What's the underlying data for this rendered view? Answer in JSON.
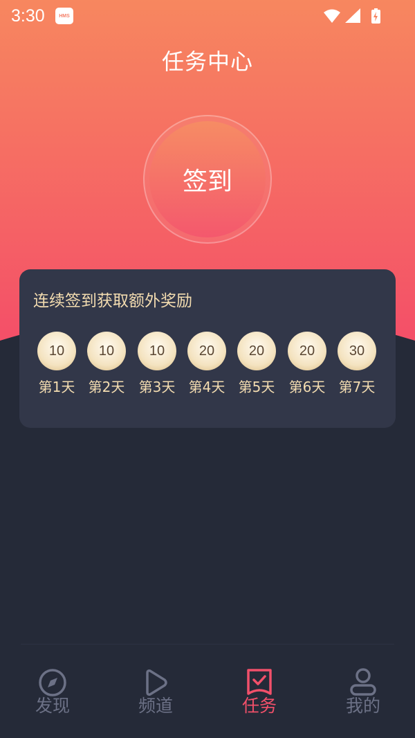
{
  "status_bar": {
    "time": "3:30",
    "badge": "HMS"
  },
  "page": {
    "title": "任务中心"
  },
  "checkin": {
    "button_label": "签到"
  },
  "reward_card": {
    "title": "连续签到获取额外奖励",
    "days": [
      {
        "points": "10",
        "label": "第1天"
      },
      {
        "points": "10",
        "label": "第2天"
      },
      {
        "points": "10",
        "label": "第3天"
      },
      {
        "points": "20",
        "label": "第4天"
      },
      {
        "points": "20",
        "label": "第5天"
      },
      {
        "points": "20",
        "label": "第6天"
      },
      {
        "points": "30",
        "label": "第7天"
      }
    ]
  },
  "bottom_nav": {
    "items": [
      {
        "label": "发现",
        "icon": "compass-icon",
        "active": false
      },
      {
        "label": "频道",
        "icon": "play-icon",
        "active": false
      },
      {
        "label": "任务",
        "icon": "task-check-icon",
        "active": true
      },
      {
        "label": "我的",
        "icon": "user-icon",
        "active": false
      }
    ]
  },
  "colors": {
    "header_top": "#f7845f",
    "header_bottom": "#f4596c",
    "background": "#252a38",
    "card": "#323749",
    "gold_text": "#f3dcb0",
    "active": "#f2506a",
    "inactive": "#6c7186"
  }
}
